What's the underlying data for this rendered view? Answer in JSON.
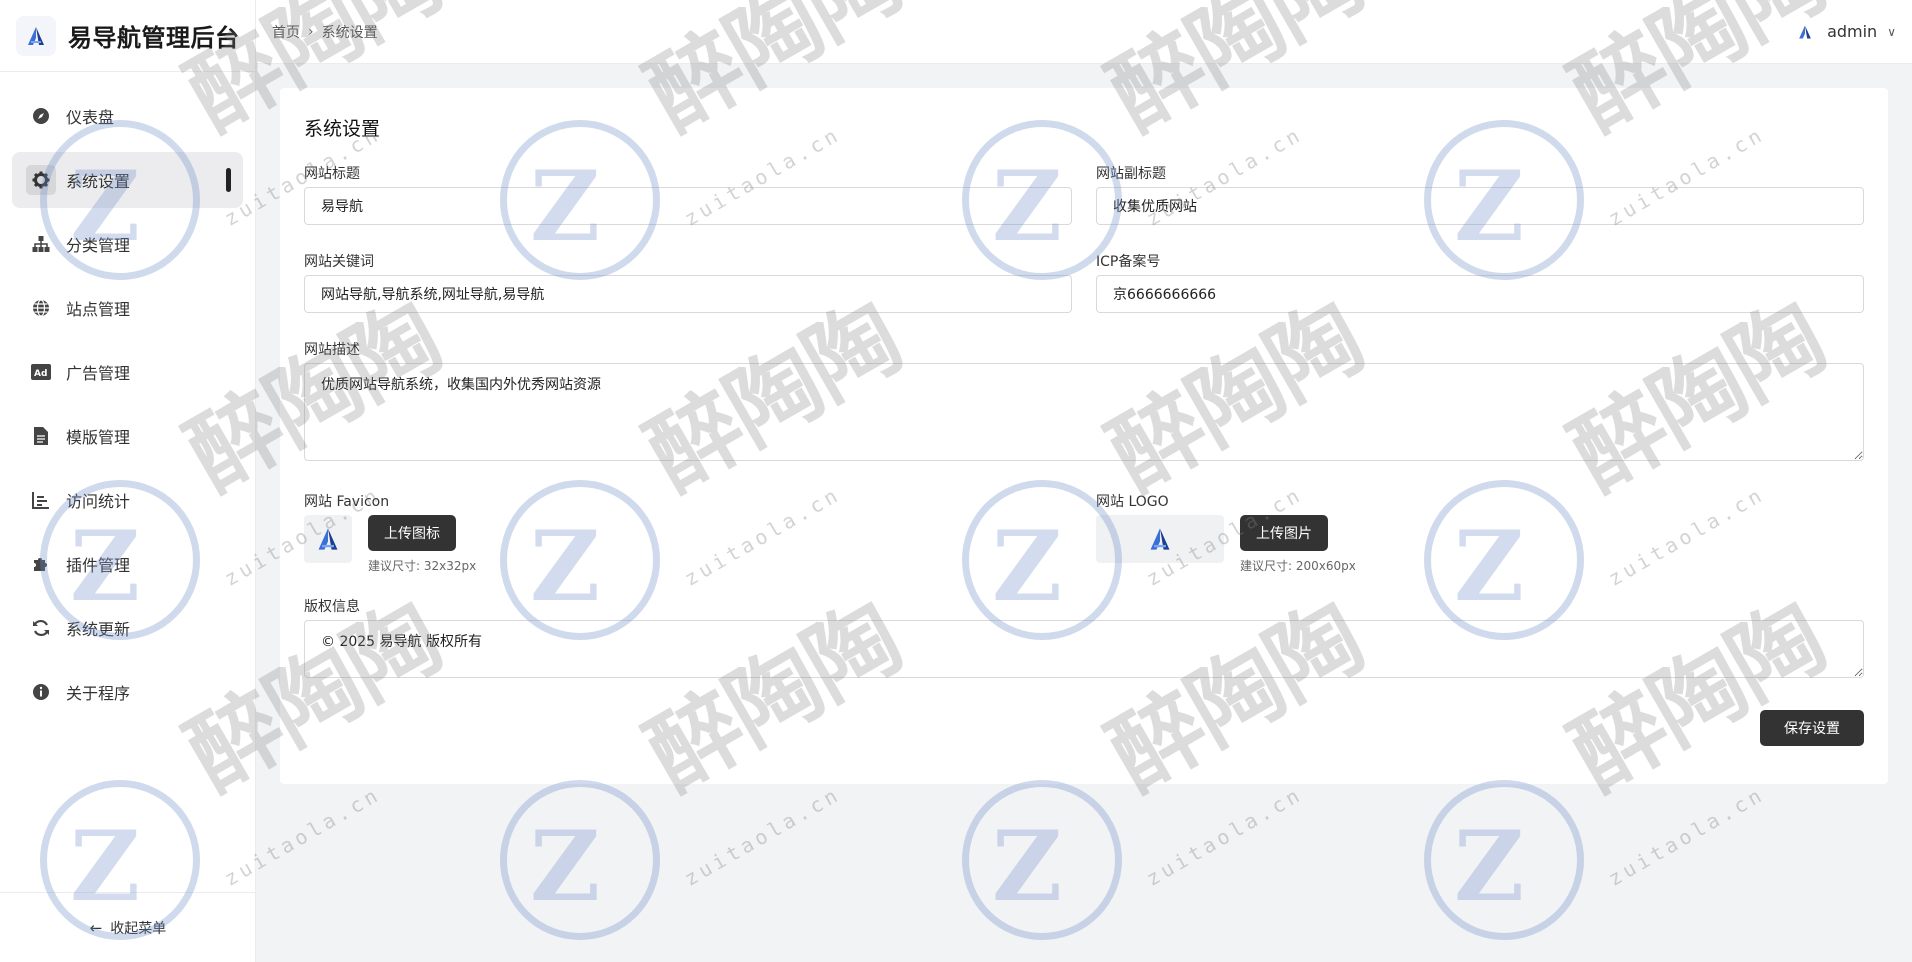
{
  "brand": {
    "title": "易导航管理后台"
  },
  "sidebar": {
    "items": [
      {
        "label": "仪表盘",
        "icon": "compass-icon"
      },
      {
        "label": "系统设置",
        "icon": "gear-icon",
        "active": true
      },
      {
        "label": "分类管理",
        "icon": "sitemap-icon"
      },
      {
        "label": "站点管理",
        "icon": "globe-icon"
      },
      {
        "label": "广告管理",
        "icon": "ad-icon"
      },
      {
        "label": "模版管理",
        "icon": "file-icon"
      },
      {
        "label": "访问统计",
        "icon": "chart-icon"
      },
      {
        "label": "插件管理",
        "icon": "puzzle-icon"
      },
      {
        "label": "系统更新",
        "icon": "refresh-icon"
      },
      {
        "label": "关于程序",
        "icon": "info-icon"
      }
    ],
    "collapse_label": "收起菜单"
  },
  "header": {
    "breadcrumb": [
      "首页",
      "系统设置"
    ],
    "user": "admin"
  },
  "form": {
    "title": "系统设置",
    "site_title_label": "网站标题",
    "site_title_value": "易导航",
    "site_subtitle_label": "网站副标题",
    "site_subtitle_value": "收集优质网站",
    "keywords_label": "网站关键词",
    "keywords_value": "网站导航,导航系统,网址导航,易导航",
    "icp_label": "ICP备案号",
    "icp_value": "京6666666666",
    "desc_label": "网站描述",
    "desc_value": "优质网站导航系统，收集国内外优秀网站资源",
    "favicon_label": "网站 Favicon",
    "favicon_button": "上传图标",
    "favicon_hint": "建议尺寸: 32x32px",
    "logo_label": "网站 LOGO",
    "logo_button": "上传图片",
    "logo_hint": "建议尺寸: 200x60px",
    "copyright_label": "版权信息",
    "copyright_value": "© 2025 易导航 版权所有",
    "save_button": "保存设置"
  },
  "watermark": {
    "text": "醉陶陶",
    "site": "zuitaola.cn"
  },
  "colors": {
    "accent": "#333333",
    "active_bg": "#ececee",
    "page_bg": "#f2f3f5"
  }
}
